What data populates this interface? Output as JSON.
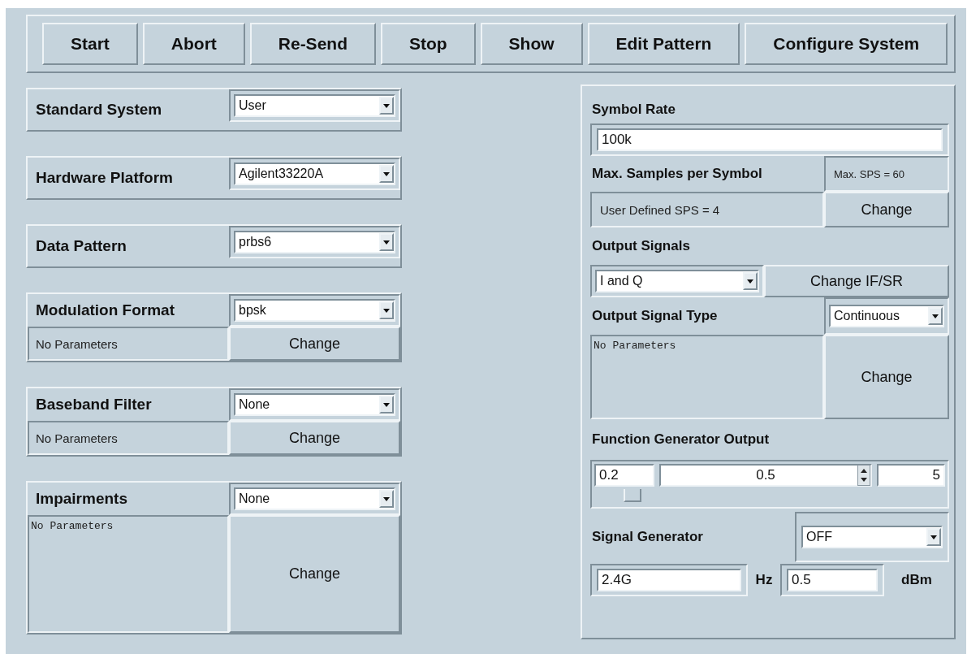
{
  "toolbar": {
    "buttons": [
      "Start",
      "Abort",
      "Re-Send",
      "Stop",
      "Show",
      "Edit Pattern",
      "Configure System"
    ]
  },
  "left_groups": [
    {
      "kind": "simple",
      "label": "Standard System",
      "dropdown": "User"
    },
    {
      "kind": "simple",
      "label": "Hardware Platform",
      "dropdown": "Agilent33220A"
    },
    {
      "kind": "simple",
      "label": "Data Pattern",
      "dropdown": "prbs6"
    },
    {
      "kind": "small_params",
      "label": "Modulation Format",
      "dropdown": "bpsk",
      "params": "No Parameters",
      "button": "Change"
    },
    {
      "kind": "small_params",
      "label": "Baseband Filter",
      "dropdown": "None",
      "params": "No Parameters",
      "button": "Change"
    },
    {
      "kind": "large_params",
      "label": "Impairments",
      "dropdown": "None",
      "params": "No Parameters",
      "button": "Change"
    }
  ],
  "right_panel": {
    "symbol_rate": {
      "label": "Symbol Rate",
      "value": "100k"
    },
    "max_sps": {
      "label": "Max. Samples per Symbol",
      "max_text": "Max. SPS = 60",
      "user_text": "User Defined SPS = 4",
      "button": "Change"
    },
    "output_signals": {
      "label": "Output Signals",
      "dropdown": "I and Q",
      "button": "Change IF/SR"
    },
    "output_signal_type": {
      "label": "Output Signal Type",
      "dropdown": "Continuous",
      "params": "No Parameters",
      "button": "Change"
    },
    "function_generator": {
      "label": "Function Generator Output",
      "min": "0.2",
      "value": "0.5",
      "max": "5",
      "level": 0.08
    },
    "signal_generator": {
      "label": "Signal Generator",
      "dropdown": "OFF",
      "frequency": "2.4G",
      "frequency_unit": "Hz",
      "power": "0.5",
      "power_unit": "dBm"
    }
  }
}
